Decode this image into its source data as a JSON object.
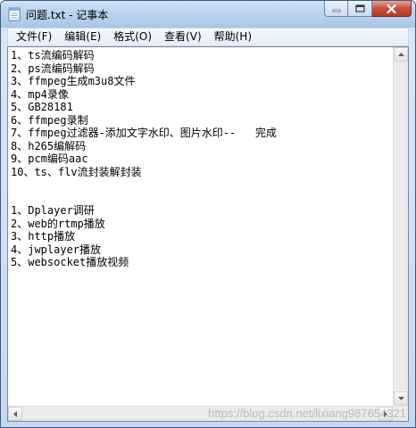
{
  "window": {
    "title": "问题.txt - 记事本"
  },
  "menu": [
    {
      "label": "文件(F)"
    },
    {
      "label": "编辑(E)"
    },
    {
      "label": "格式(O)"
    },
    {
      "label": "查看(V)"
    },
    {
      "label": "帮助(H)"
    }
  ],
  "document": {
    "lines": [
      "1、ts流编码解码",
      "2、ps流编码解码",
      "3、ffmpeg生成m3u8文件",
      "4、mp4录像",
      "5、GB28181",
      "6、ffmpeg录制",
      "7、ffmpeg过滤器-添加文字水印、图片水印--   完成",
      "8、h265编解码",
      "9、pcm编码aac",
      "10、ts、flv流封装解封装",
      "",
      "",
      "1、Dplayer调研",
      "2、web的rtmp播放",
      "3、http播放",
      "4、jwplayer播放",
      "5、websocket播放视频"
    ]
  },
  "watermark": "https://blog.csdn.net/lixiang987654321",
  "colors": {
    "title_bar": "#b9d2ee",
    "close_button": "#c8503a",
    "text": "#000000",
    "editor_background": "#ffffff"
  },
  "icons": {
    "app": "notepad-icon",
    "minimize": "minimize-icon",
    "maximize": "maximize-icon",
    "close": "close-icon"
  }
}
